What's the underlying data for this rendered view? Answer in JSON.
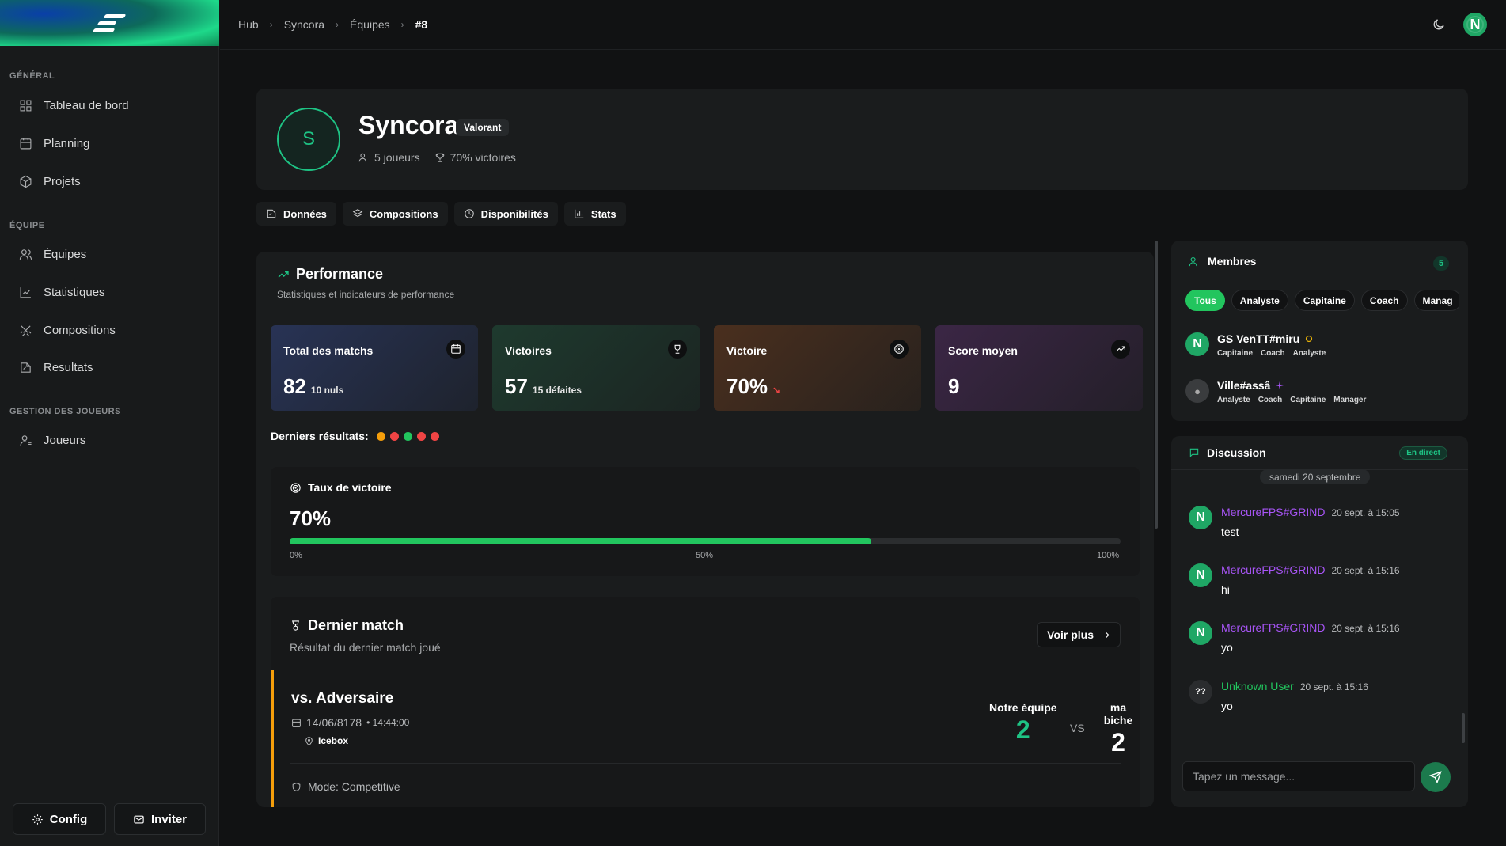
{
  "breadcrumb": [
    "Hub",
    "Syncora",
    "Équipes",
    "#8"
  ],
  "user_initial": "N",
  "sidebar": {
    "sections": [
      {
        "title": "GÉNÉRAL",
        "items": [
          "Tableau de bord",
          "Planning",
          "Projets"
        ]
      },
      {
        "title": "ÉQUIPE",
        "items": [
          "Équipes",
          "Statistiques",
          "Compositions",
          "Resultats"
        ]
      },
      {
        "title": "GESTION DES JOUEURS",
        "items": [
          "Joueurs"
        ]
      }
    ],
    "config_label": "Config",
    "invite_label": "Inviter"
  },
  "team": {
    "initial": "S",
    "name": "Syncora",
    "game": "Valorant",
    "players": "5 joueurs",
    "winrate": "70% victoires"
  },
  "tabs": [
    "Données",
    "Compositions",
    "Disponibilités",
    "Stats"
  ],
  "performance": {
    "title": "Performance",
    "subtitle": "Statistiques et indicateurs de performance",
    "stats": [
      {
        "label": "Total des matchs",
        "value": "82",
        "sub": "10 nuls",
        "color": "#283355"
      },
      {
        "label": "Victoires",
        "value": "57",
        "sub": "15 défaites",
        "color": "#1e3a2e"
      },
      {
        "label": "Victoire",
        "value": "70%",
        "sub": "↘",
        "color": "#4a2f1e"
      },
      {
        "label": "Score moyen",
        "value": "9",
        "sub": "",
        "color": "#3b2645"
      }
    ],
    "recent_label": "Derniers résultats:",
    "recent_colors": [
      "#f59e0b",
      "#ef4444",
      "#22c55e",
      "#ef4444",
      "#ef4444"
    ],
    "rate": {
      "title": "Taux de victoire",
      "value": "70%",
      "progress": 0.7,
      "ticks": [
        "0%",
        "50%",
        "100%"
      ]
    }
  },
  "last_match": {
    "title": "Dernier match",
    "subtitle": "Résultat du dernier match joué",
    "more": "Voir plus",
    "opponent": "vs. Adversaire",
    "date": "14/06/8178",
    "time": "• 14:44:00",
    "map": "Icebox",
    "mode": "Mode: Competitive",
    "home_name": "Notre équipe",
    "home_score": "2",
    "away_name": "ma biche",
    "away_score": "2",
    "vs": "VS"
  },
  "members": {
    "title": "Membres",
    "count": "5",
    "filters": [
      "Tous",
      "Analyste",
      "Capitaine",
      "Coach",
      "Manag"
    ],
    "list": [
      {
        "name": "GS VenTT#miru",
        "roles": [
          "Capitaine",
          "Coach",
          "Analyste"
        ]
      },
      {
        "name": "Ville#assâ",
        "roles": [
          "Analyste",
          "Coach",
          "Capitaine",
          "Manager"
        ]
      }
    ]
  },
  "chat": {
    "title": "Discussion",
    "live": "En direct",
    "date": "samedi 20 septembre",
    "messages": [
      {
        "author": "MercureFPS#GRIND",
        "time": "20 sept. à 15:05",
        "text": "test"
      },
      {
        "author": "MercureFPS#GRIND",
        "time": "20 sept. à 15:16",
        "text": "hi"
      },
      {
        "author": "MercureFPS#GRIND",
        "time": "20 sept. à 15:16",
        "text": "yo"
      },
      {
        "author": "Unknown User",
        "time": "20 sept. à 15:16",
        "text": "yo",
        "avatar": "??"
      }
    ],
    "placeholder": "Tapez un message..."
  }
}
